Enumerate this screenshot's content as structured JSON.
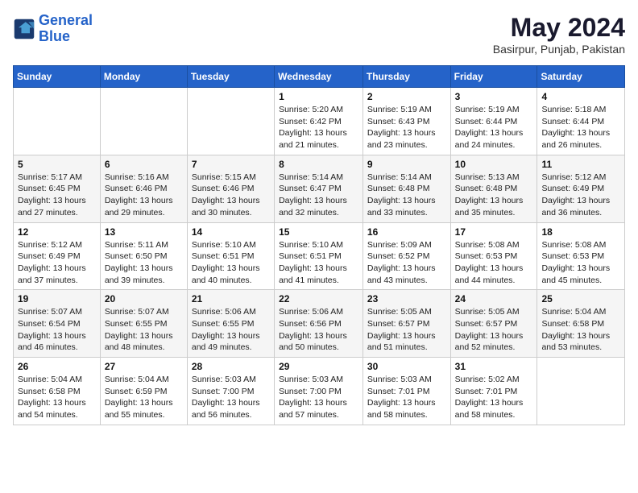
{
  "logo": {
    "line1": "General",
    "line2": "Blue"
  },
  "title": {
    "month_year": "May 2024",
    "location": "Basirpur, Punjab, Pakistan"
  },
  "days_of_week": [
    "Sunday",
    "Monday",
    "Tuesday",
    "Wednesday",
    "Thursday",
    "Friday",
    "Saturday"
  ],
  "weeks": [
    [
      {
        "day": "",
        "info": ""
      },
      {
        "day": "",
        "info": ""
      },
      {
        "day": "",
        "info": ""
      },
      {
        "day": "1",
        "info": "Sunrise: 5:20 AM\nSunset: 6:42 PM\nDaylight: 13 hours\nand 21 minutes."
      },
      {
        "day": "2",
        "info": "Sunrise: 5:19 AM\nSunset: 6:43 PM\nDaylight: 13 hours\nand 23 minutes."
      },
      {
        "day": "3",
        "info": "Sunrise: 5:19 AM\nSunset: 6:44 PM\nDaylight: 13 hours\nand 24 minutes."
      },
      {
        "day": "4",
        "info": "Sunrise: 5:18 AM\nSunset: 6:44 PM\nDaylight: 13 hours\nand 26 minutes."
      }
    ],
    [
      {
        "day": "5",
        "info": "Sunrise: 5:17 AM\nSunset: 6:45 PM\nDaylight: 13 hours\nand 27 minutes."
      },
      {
        "day": "6",
        "info": "Sunrise: 5:16 AM\nSunset: 6:46 PM\nDaylight: 13 hours\nand 29 minutes."
      },
      {
        "day": "7",
        "info": "Sunrise: 5:15 AM\nSunset: 6:46 PM\nDaylight: 13 hours\nand 30 minutes."
      },
      {
        "day": "8",
        "info": "Sunrise: 5:14 AM\nSunset: 6:47 PM\nDaylight: 13 hours\nand 32 minutes."
      },
      {
        "day": "9",
        "info": "Sunrise: 5:14 AM\nSunset: 6:48 PM\nDaylight: 13 hours\nand 33 minutes."
      },
      {
        "day": "10",
        "info": "Sunrise: 5:13 AM\nSunset: 6:48 PM\nDaylight: 13 hours\nand 35 minutes."
      },
      {
        "day": "11",
        "info": "Sunrise: 5:12 AM\nSunset: 6:49 PM\nDaylight: 13 hours\nand 36 minutes."
      }
    ],
    [
      {
        "day": "12",
        "info": "Sunrise: 5:12 AM\nSunset: 6:49 PM\nDaylight: 13 hours\nand 37 minutes."
      },
      {
        "day": "13",
        "info": "Sunrise: 5:11 AM\nSunset: 6:50 PM\nDaylight: 13 hours\nand 39 minutes."
      },
      {
        "day": "14",
        "info": "Sunrise: 5:10 AM\nSunset: 6:51 PM\nDaylight: 13 hours\nand 40 minutes."
      },
      {
        "day": "15",
        "info": "Sunrise: 5:10 AM\nSunset: 6:51 PM\nDaylight: 13 hours\nand 41 minutes."
      },
      {
        "day": "16",
        "info": "Sunrise: 5:09 AM\nSunset: 6:52 PM\nDaylight: 13 hours\nand 43 minutes."
      },
      {
        "day": "17",
        "info": "Sunrise: 5:08 AM\nSunset: 6:53 PM\nDaylight: 13 hours\nand 44 minutes."
      },
      {
        "day": "18",
        "info": "Sunrise: 5:08 AM\nSunset: 6:53 PM\nDaylight: 13 hours\nand 45 minutes."
      }
    ],
    [
      {
        "day": "19",
        "info": "Sunrise: 5:07 AM\nSunset: 6:54 PM\nDaylight: 13 hours\nand 46 minutes."
      },
      {
        "day": "20",
        "info": "Sunrise: 5:07 AM\nSunset: 6:55 PM\nDaylight: 13 hours\nand 48 minutes."
      },
      {
        "day": "21",
        "info": "Sunrise: 5:06 AM\nSunset: 6:55 PM\nDaylight: 13 hours\nand 49 minutes."
      },
      {
        "day": "22",
        "info": "Sunrise: 5:06 AM\nSunset: 6:56 PM\nDaylight: 13 hours\nand 50 minutes."
      },
      {
        "day": "23",
        "info": "Sunrise: 5:05 AM\nSunset: 6:57 PM\nDaylight: 13 hours\nand 51 minutes."
      },
      {
        "day": "24",
        "info": "Sunrise: 5:05 AM\nSunset: 6:57 PM\nDaylight: 13 hours\nand 52 minutes."
      },
      {
        "day": "25",
        "info": "Sunrise: 5:04 AM\nSunset: 6:58 PM\nDaylight: 13 hours\nand 53 minutes."
      }
    ],
    [
      {
        "day": "26",
        "info": "Sunrise: 5:04 AM\nSunset: 6:58 PM\nDaylight: 13 hours\nand 54 minutes."
      },
      {
        "day": "27",
        "info": "Sunrise: 5:04 AM\nSunset: 6:59 PM\nDaylight: 13 hours\nand 55 minutes."
      },
      {
        "day": "28",
        "info": "Sunrise: 5:03 AM\nSunset: 7:00 PM\nDaylight: 13 hours\nand 56 minutes."
      },
      {
        "day": "29",
        "info": "Sunrise: 5:03 AM\nSunset: 7:00 PM\nDaylight: 13 hours\nand 57 minutes."
      },
      {
        "day": "30",
        "info": "Sunrise: 5:03 AM\nSunset: 7:01 PM\nDaylight: 13 hours\nand 58 minutes."
      },
      {
        "day": "31",
        "info": "Sunrise: 5:02 AM\nSunset: 7:01 PM\nDaylight: 13 hours\nand 58 minutes."
      },
      {
        "day": "",
        "info": ""
      }
    ]
  ]
}
